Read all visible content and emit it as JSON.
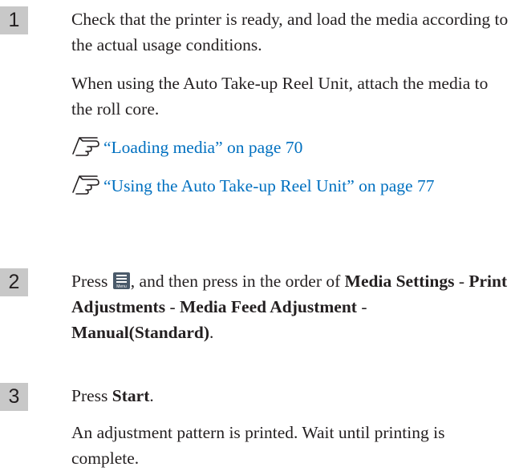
{
  "steps": [
    {
      "number": "1",
      "paragraphs": [
        "Check that the printer is ready, and load the media according to the actual usage conditions.",
        "When using the Auto Take-up Reel Unit, attach the media to the roll core."
      ],
      "links": [
        "“Loading media” on page 70",
        "“Using the Auto Take-up Reel Unit” on page 77"
      ]
    },
    {
      "number": "2",
      "text_press": "Press ",
      "menu_icon_label": "Menu",
      "text_after_icon": ", and then press in the order of ",
      "bold_1": "Media Settings",
      "sep": " - ",
      "bold_2": "Print Adjustments",
      "bold_3": "Media Feed Adjustment",
      "bold_4": "Manual(Standard)",
      "end": "."
    },
    {
      "number": "3",
      "text_press": "Press ",
      "bold_1": "Start",
      "end": ".",
      "paragraph": "An adjustment pattern is printed. Wait until printing is complete."
    }
  ],
  "icons": {
    "reference": "hand-pointing-reference-icon",
    "menu": "menu-button-icon"
  },
  "colors": {
    "link": "#0070c0",
    "step_badge": "#c8c8c8",
    "text": "#231f20"
  }
}
